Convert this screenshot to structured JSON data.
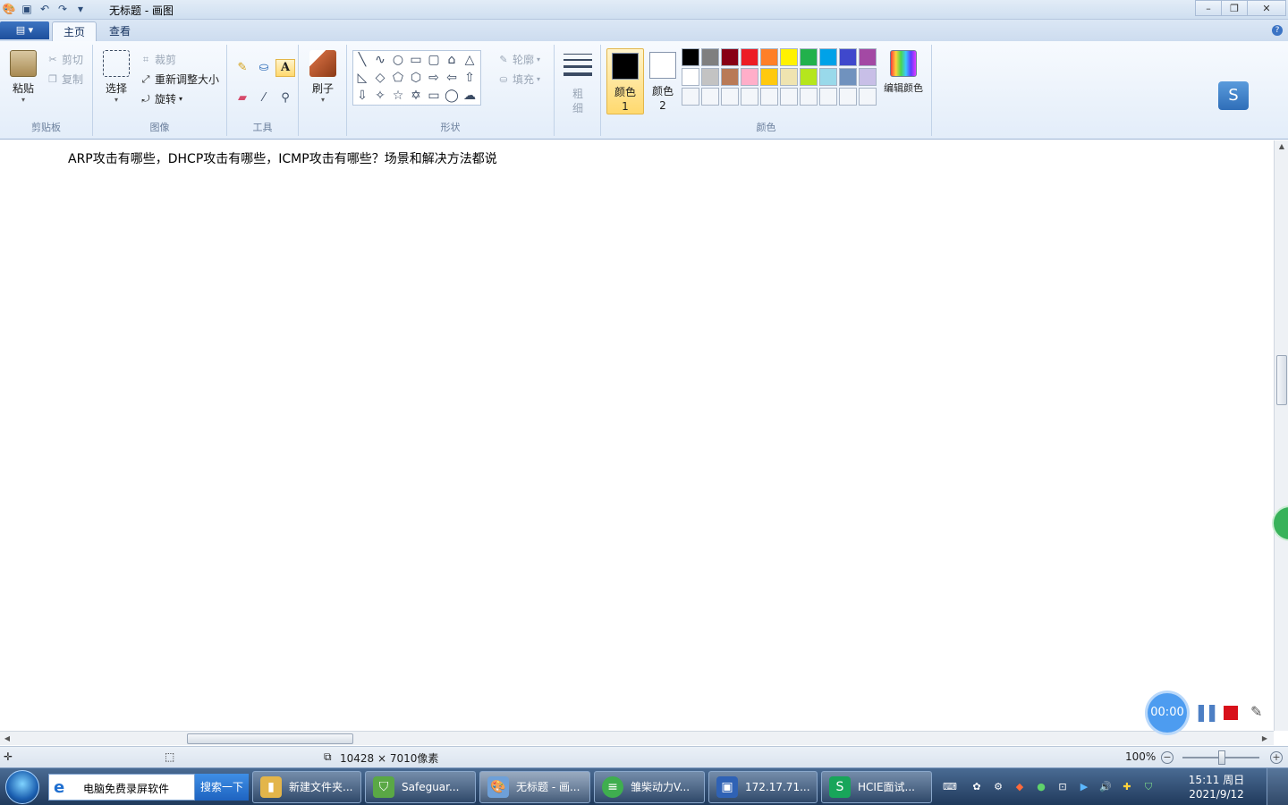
{
  "window": {
    "title": "无标题 - 画图",
    "controls": {
      "minimize": "–",
      "restore": "❐",
      "close": "✕"
    }
  },
  "quick_access": {
    "save_icon": "save-icon",
    "undo_icon": "undo-icon",
    "redo_icon": "redo-icon"
  },
  "ribbon": {
    "app_menu": "▤ ▾",
    "tabs": [
      {
        "label": "主页",
        "active": true
      },
      {
        "label": "查看",
        "active": false
      }
    ],
    "clipboard": {
      "paste": "粘贴",
      "cut": "剪切",
      "copy": "复制",
      "group": "剪贴板"
    },
    "image": {
      "select": "选择",
      "crop": "裁剪",
      "resize": "重新调整大小",
      "rotate": "旋转",
      "group": "图像"
    },
    "tools": {
      "group": "工具"
    },
    "brushes": {
      "label": "刷子"
    },
    "shapes": {
      "outline": "轮廓",
      "fill": "填充",
      "group": "形状"
    },
    "size": {
      "label": "粗细"
    },
    "colors": {
      "color1_label": "颜色 1",
      "color2_label": "颜色 2",
      "edit": "编辑颜色",
      "group": "颜色",
      "color1": "#000000",
      "color2": "#ffffff",
      "palette_row1": [
        "#000000",
        "#7f7f7f",
        "#880015",
        "#ed1c24",
        "#ff7f27",
        "#fff200",
        "#22b14c",
        "#00a2e8",
        "#3f48cc",
        "#a349a4"
      ],
      "palette_row2": [
        "#ffffff",
        "#c3c3c3",
        "#b97a57",
        "#ffaec9",
        "#ffc90e",
        "#efe4b0",
        "#b5e61d",
        "#99d9ea",
        "#7092be",
        "#c8bfe7"
      ]
    }
  },
  "canvas": {
    "text": "ARP攻击有哪些，DHCP攻击有哪些，ICMP攻击有哪些？场景和解决方法都说"
  },
  "statusbar": {
    "dimensions": "10428 × 7010像素",
    "zoom": "100%"
  },
  "recorder": {
    "timer": "00:00"
  },
  "taskbar": {
    "search_text": "电脑免费录屏软件",
    "search_button": "搜索一下",
    "tasks": [
      {
        "label": "新建文件夹...",
        "icon": "folder-icon",
        "color": "#e3b54a"
      },
      {
        "label": "Safeguar...",
        "icon": "shield-icon",
        "color": "#5aa845"
      },
      {
        "label": "无标题 - 画...",
        "icon": "paint-icon",
        "color": "#6ea0d8"
      },
      {
        "label": "雏柴动力V...",
        "icon": "app-icon",
        "color": "#3fae4f"
      },
      {
        "label": "172.17.71...",
        "icon": "remote-desktop-icon",
        "color": "#2f62b5"
      },
      {
        "label": "HCIE面试...",
        "icon": "wps-icon",
        "color": "#18a55a"
      }
    ],
    "clock_time": "15:11 周日",
    "clock_date": "2021/9/12"
  }
}
